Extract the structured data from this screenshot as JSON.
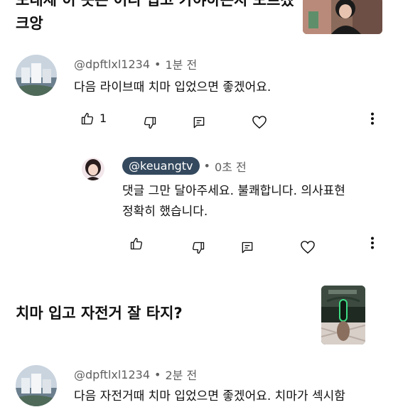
{
  "video1": {
    "title_line1": "모내세 이 옷은 어디 입고 가야하는지 모르겠",
    "title_line2": "크앙"
  },
  "comment1": {
    "handle": "@dpftlxl1234",
    "separator": "•",
    "time": "1분 전",
    "text": "다음 라이브때 치마 입었으면 좋겠어요.",
    "like_count": "1"
  },
  "reply1": {
    "handle": "@keuangtv",
    "separator": "•",
    "time": "0초 전",
    "text_line1": "댓글 그만 달아주세요. 불쾌합니다. 의사표현",
    "text_line2": "정확히 했습니다."
  },
  "video2": {
    "title": "치마 입고 자전거 잘 타지?"
  },
  "comment2": {
    "handle": "@dpftlxl1234",
    "separator": "•",
    "time": "2분 전",
    "text": "다음 자전거때 치마 입었으면 좋겠어요. 치마가 섹시함"
  },
  "colors": {
    "text": "#0f0f0f",
    "secondary": "#606060",
    "badge_bg": "#34495e"
  }
}
